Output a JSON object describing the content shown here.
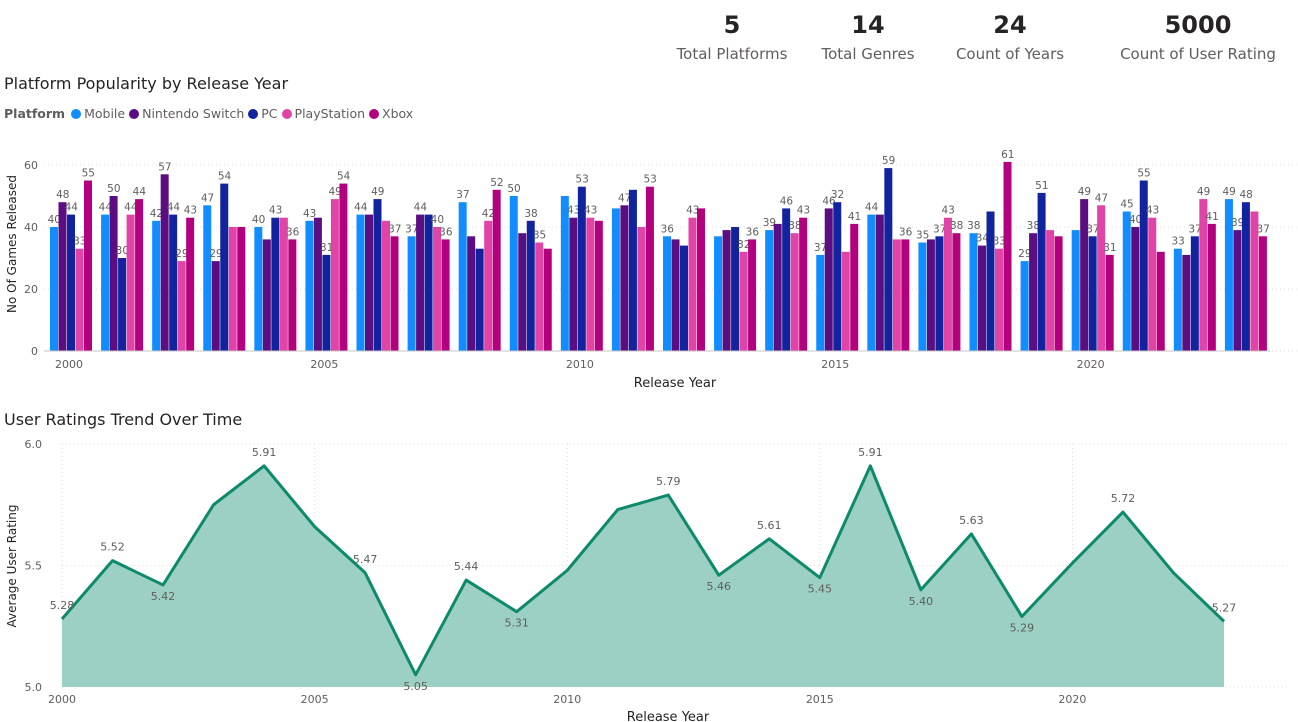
{
  "kpis": [
    {
      "value": "5",
      "label": "Total Platforms"
    },
    {
      "value": "14",
      "label": "Total Genres"
    },
    {
      "value": "24",
      "label": "Count of Years"
    },
    {
      "value": "5000",
      "label": "Count of User Rating"
    }
  ],
  "colors": {
    "Mobile": "#118dff",
    "Nintendo Switch": "#5b0e82",
    "PC": "#12239e",
    "PlayStation": "#e044a7",
    "Xbox": "#b3007f",
    "area_line": "#0d8a6a",
    "area_fill": "#9cd0c4"
  },
  "legend": {
    "title": "Platform"
  },
  "chart_data": [
    {
      "type": "bar",
      "title": "Platform Popularity by Release Year",
      "xlabel": "Release Year",
      "ylabel": "No Of Games Released",
      "ylim": [
        0,
        65
      ],
      "yticks": [
        0,
        20,
        40,
        60
      ],
      "x_tick_labels": [
        "2000",
        "2005",
        "2010",
        "2015",
        "2020"
      ],
      "grid": true,
      "legend_position": "top-left",
      "categories": [
        2000,
        2001,
        2002,
        2003,
        2004,
        2005,
        2006,
        2007,
        2008,
        2009,
        2010,
        2011,
        2012,
        2013,
        2014,
        2015,
        2016,
        2017,
        2018,
        2019,
        2020,
        2021,
        2022,
        2023
      ],
      "series": [
        {
          "name": "Mobile",
          "values": [
            40,
            44,
            42,
            47,
            40,
            42,
            44,
            37,
            48,
            50,
            50,
            46,
            37,
            37,
            39,
            31,
            44,
            35,
            38,
            29,
            39,
            45,
            33,
            49
          ]
        },
        {
          "name": "Nintendo Switch",
          "values": [
            48,
            50,
            57,
            29,
            36,
            43,
            44,
            44,
            37,
            38,
            43,
            47,
            36,
            39,
            41,
            46,
            44,
            36,
            34,
            38,
            49,
            40,
            31,
            39
          ]
        },
        {
          "name": "PC",
          "values": [
            44,
            30,
            44,
            54,
            43,
            31,
            49,
            44,
            33,
            42,
            53,
            52,
            34,
            40,
            46,
            48,
            59,
            37,
            45,
            51,
            37,
            55,
            37,
            48
          ]
        },
        {
          "name": "PlayStation",
          "values": [
            33,
            44,
            29,
            40,
            43,
            49,
            42,
            40,
            42,
            35,
            43,
            40,
            43,
            32,
            38,
            32,
            36,
            43,
            33,
            39,
            47,
            43,
            49,
            45
          ]
        },
        {
          "name": "Xbox",
          "values": [
            55,
            49,
            43,
            40,
            36,
            54,
            37,
            36,
            52,
            33,
            42,
            53,
            46,
            36,
            43,
            41,
            36,
            38,
            61,
            37,
            31,
            32,
            41,
            37
          ]
        }
      ],
      "data_labels": [
        [
          40,
          48,
          44,
          33,
          55
        ],
        [
          44,
          50,
          30,
          44,
          44
        ],
        [
          42,
          57,
          44,
          29,
          43
        ],
        [
          47,
          29,
          54,
          null,
          null
        ],
        [
          40,
          null,
          43,
          null,
          36
        ],
        [
          43,
          null,
          31,
          49,
          54
        ],
        [
          44,
          null,
          49,
          null,
          37
        ],
        [
          37,
          44,
          null,
          40,
          36
        ],
        [
          37,
          null,
          null,
          42,
          52
        ],
        [
          50,
          null,
          38,
          35,
          null
        ],
        [
          null,
          43,
          53,
          43,
          null
        ],
        [
          null,
          47,
          null,
          null,
          53
        ],
        [
          36,
          null,
          null,
          43,
          null
        ],
        [
          null,
          null,
          null,
          32,
          36
        ],
        [
          39,
          null,
          46,
          38,
          43
        ],
        [
          37,
          46,
          32,
          null,
          41
        ],
        [
          44,
          null,
          59,
          null,
          36
        ],
        [
          35,
          null,
          37,
          43,
          38
        ],
        [
          38,
          34,
          null,
          33,
          61
        ],
        [
          29,
          38,
          51,
          null,
          null
        ],
        [
          null,
          49,
          37,
          47,
          31
        ],
        [
          45,
          40,
          55,
          43,
          null
        ],
        [
          33,
          null,
          37,
          49,
          41
        ],
        [
          49,
          39,
          48,
          null,
          37
        ]
      ]
    },
    {
      "type": "area",
      "title": "User Ratings Trend Over Time",
      "xlabel": "Release Year",
      "ylabel": "Average User Rating",
      "ylim": [
        5.0,
        6.0
      ],
      "yticks": [
        "5.0",
        "5.5",
        "6.0"
      ],
      "x_tick_labels": [
        "2000",
        "2005",
        "2010",
        "2015",
        "2020"
      ],
      "grid": true,
      "x": [
        2000,
        2001,
        2002,
        2003,
        2004,
        2005,
        2006,
        2007,
        2008,
        2009,
        2010,
        2011,
        2012,
        2013,
        2014,
        2015,
        2016,
        2017,
        2018,
        2019,
        2020,
        2021,
        2022,
        2023
      ],
      "y": [
        5.28,
        5.52,
        5.42,
        5.75,
        5.91,
        5.66,
        5.47,
        5.05,
        5.44,
        5.31,
        5.48,
        5.73,
        5.79,
        5.46,
        5.61,
        5.45,
        5.91,
        5.4,
        5.63,
        5.29,
        5.51,
        5.72,
        5.47,
        5.27
      ],
      "point_labels": [
        "5.28",
        "5.52",
        "5.42",
        null,
        "5.91",
        null,
        "5.47",
        "5.05",
        "5.44",
        "5.31",
        null,
        null,
        "5.79",
        "5.46",
        "5.61",
        "5.45",
        "5.91",
        "5.40",
        "5.63",
        "5.29",
        null,
        "5.72",
        null,
        "5.27"
      ]
    }
  ]
}
